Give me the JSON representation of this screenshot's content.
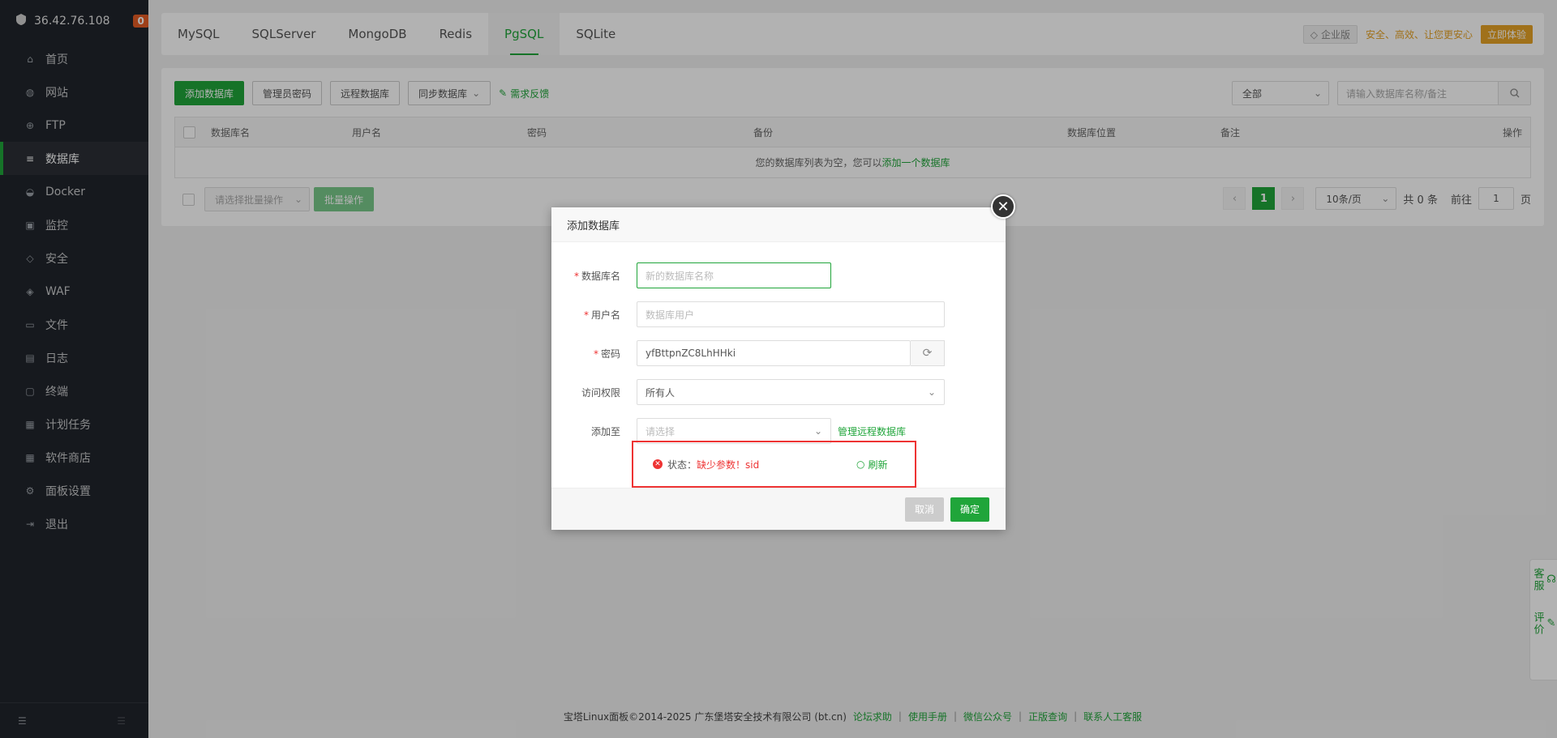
{
  "sidebar": {
    "ip": "36.42.76.108",
    "badge": "0",
    "items": [
      {
        "label": "首页",
        "icon": "home-icon"
      },
      {
        "label": "网站",
        "icon": "globe-icon"
      },
      {
        "label": "FTP",
        "icon": "ftp-icon"
      },
      {
        "label": "数据库",
        "icon": "database-icon"
      },
      {
        "label": "Docker",
        "icon": "docker-icon"
      },
      {
        "label": "监控",
        "icon": "monitor-icon"
      },
      {
        "label": "安全",
        "icon": "shield-icon"
      },
      {
        "label": "WAF",
        "icon": "waf-icon"
      },
      {
        "label": "文件",
        "icon": "folder-icon"
      },
      {
        "label": "日志",
        "icon": "log-icon"
      },
      {
        "label": "终端",
        "icon": "terminal-icon"
      },
      {
        "label": "计划任务",
        "icon": "calendar-icon"
      },
      {
        "label": "软件商店",
        "icon": "apps-icon"
      },
      {
        "label": "面板设置",
        "icon": "gear-icon"
      },
      {
        "label": "退出",
        "icon": "logout-icon"
      }
    ]
  },
  "tabs": [
    "MySQL",
    "SQLServer",
    "MongoDB",
    "Redis",
    "PgSQL",
    "SQLite"
  ],
  "enterprise": {
    "tag": "企业版",
    "slogan": "安全、高效、让您更安心",
    "button": "立即体验"
  },
  "toolbar": {
    "add_db": "添加数据库",
    "admin_pwd": "管理员密码",
    "remote_db": "远程数据库",
    "sync_db": "同步数据库",
    "feedback": "需求反馈"
  },
  "filter": {
    "select": "全部",
    "search_placeholder": "请输入数据库名称/备注"
  },
  "table": {
    "headers": [
      "数据库名",
      "用户名",
      "密码",
      "备份",
      "数据库位置",
      "备注",
      "操作"
    ],
    "empty_text": "您的数据库列表为空，您可以",
    "empty_link": "添加一个数据库"
  },
  "batch": {
    "select_placeholder": "请选择批量操作",
    "button": "批量操作"
  },
  "pager": {
    "current": "1",
    "per_page": "10条/页",
    "total": "共 0 条",
    "goto": "前往",
    "goto_value": "1",
    "page_unit": "页"
  },
  "modal": {
    "title": "添加数据库",
    "db_name_label": "数据库名",
    "db_name_placeholder": "新的数据库名称",
    "user_label": "用户名",
    "user_placeholder": "数据库用户",
    "password_label": "密码",
    "password_value": "yfBttpnZC8LhHHki",
    "access_label": "访问权限",
    "access_value": "所有人",
    "add_to_label": "添加至",
    "add_to_placeholder": "请选择",
    "manage_remote": "管理远程数据库",
    "status_label": "状态：",
    "status_msg": "缺少参数！sid",
    "refresh": "刷新",
    "cancel": "取消",
    "ok": "确定"
  },
  "footer": {
    "copyright": "宝塔Linux面板©2014-2025 广东堡塔安全技术有限公司 (bt.cn)",
    "links": [
      "论坛求助",
      "使用手册",
      "微信公众号",
      "正版查询",
      "联系人工客服"
    ]
  },
  "float": {
    "service": "客服",
    "review": "评价"
  }
}
